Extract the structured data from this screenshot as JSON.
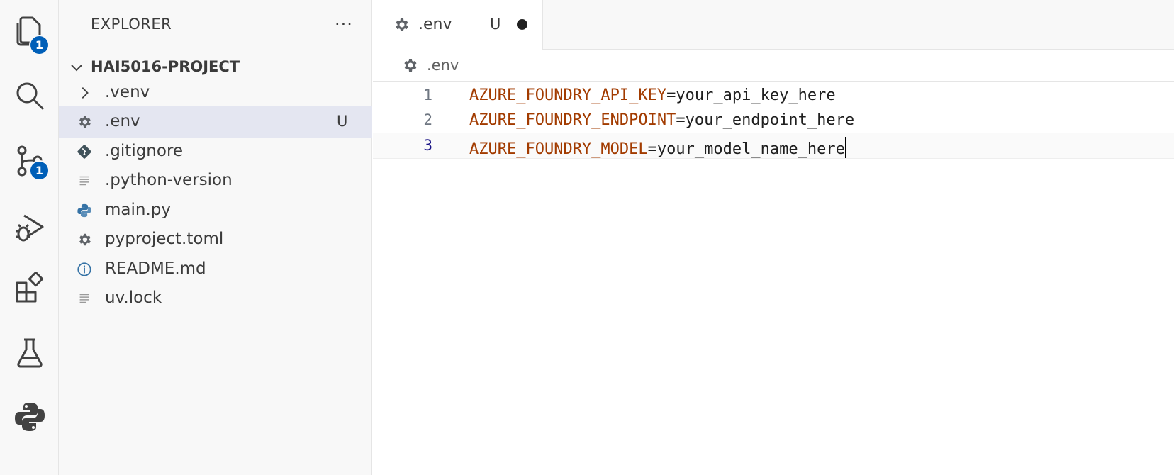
{
  "activity_bar": {
    "items": [
      {
        "icon": "files-icon",
        "badge": "1"
      },
      {
        "icon": "search-icon"
      },
      {
        "icon": "source-control-icon",
        "badge": "1"
      },
      {
        "icon": "run-debug-icon"
      },
      {
        "icon": "extensions-icon"
      },
      {
        "icon": "testing-icon"
      },
      {
        "icon": "python-icon"
      }
    ]
  },
  "sidebar": {
    "title": "EXPLORER",
    "more": "···",
    "project": "HAI5016-PROJECT",
    "items": [
      {
        "name": ".venv",
        "icon": "chevron-right-icon"
      },
      {
        "name": ".env",
        "icon": "gear-icon",
        "status": "U",
        "selected": true
      },
      {
        "name": ".gitignore",
        "icon": "git-icon"
      },
      {
        "name": ".python-version",
        "icon": "lines-icon"
      },
      {
        "name": "main.py",
        "icon": "python-icon"
      },
      {
        "name": "pyproject.toml",
        "icon": "gear-icon"
      },
      {
        "name": "README.md",
        "icon": "info-icon"
      },
      {
        "name": "uv.lock",
        "icon": "lines-icon"
      }
    ]
  },
  "editor": {
    "tab": {
      "name": ".env",
      "status": "U"
    },
    "breadcrumb": ".env",
    "lines": [
      {
        "number": "1",
        "key": "AZURE_FOUNDRY_API_KEY",
        "value": "=your_api_key_here"
      },
      {
        "number": "2",
        "key": "AZURE_FOUNDRY_ENDPOINT",
        "value": "=your_endpoint_here"
      },
      {
        "number": "3",
        "key": "AZURE_FOUNDRY_MODEL",
        "value": "=your_model_name_here"
      }
    ]
  },
  "colors": {
    "accent": "#005fb8",
    "env_key": "#a23b00",
    "selection": "#e4e6f1"
  }
}
